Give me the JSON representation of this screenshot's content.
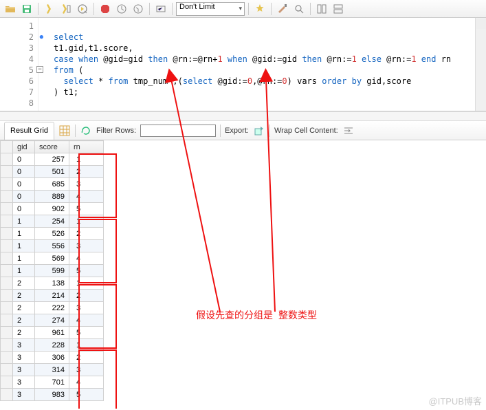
{
  "toolbar": {
    "limit_label": "Don't Limit"
  },
  "code": {
    "lines": [
      "select",
      "t1.gid,t1.score,",
      "case when @gid=gid then @rn:=@rn+1 when @gid:=gid then @rn:=1 else @rn:=1 end rn",
      "from (",
      "  select * from tmp_num ,(select @gid:=0,@rn:=0) vars order by gid,score",
      ") t1;"
    ]
  },
  "results": {
    "tab_label": "Result Grid",
    "filter_label": "Filter Rows:",
    "export_label": "Export:",
    "wrap_label": "Wrap Cell Content:",
    "columns": [
      "gid",
      "score",
      "rn"
    ],
    "rows": [
      {
        "gid": 0,
        "score": 257,
        "rn": 1
      },
      {
        "gid": 0,
        "score": 501,
        "rn": 2
      },
      {
        "gid": 0,
        "score": 685,
        "rn": 3
      },
      {
        "gid": 0,
        "score": 889,
        "rn": 4
      },
      {
        "gid": 0,
        "score": 902,
        "rn": 5
      },
      {
        "gid": 1,
        "score": 254,
        "rn": 1
      },
      {
        "gid": 1,
        "score": 526,
        "rn": 2
      },
      {
        "gid": 1,
        "score": 556,
        "rn": 3
      },
      {
        "gid": 1,
        "score": 569,
        "rn": 4
      },
      {
        "gid": 1,
        "score": 599,
        "rn": 5
      },
      {
        "gid": 2,
        "score": 138,
        "rn": 1
      },
      {
        "gid": 2,
        "score": 214,
        "rn": 2
      },
      {
        "gid": 2,
        "score": 222,
        "rn": 3
      },
      {
        "gid": 2,
        "score": 274,
        "rn": 4
      },
      {
        "gid": 2,
        "score": 961,
        "rn": 5
      },
      {
        "gid": 3,
        "score": 228,
        "rn": 1
      },
      {
        "gid": 3,
        "score": 306,
        "rn": 2
      },
      {
        "gid": 3,
        "score": 314,
        "rn": 3
      },
      {
        "gid": 3,
        "score": 701,
        "rn": 4
      },
      {
        "gid": 3,
        "score": 983,
        "rn": 5
      }
    ]
  },
  "annotation": {
    "text_left": "假设先查的分组是",
    "text_right": "整数类型"
  },
  "watermark": "@ITPUB博客"
}
